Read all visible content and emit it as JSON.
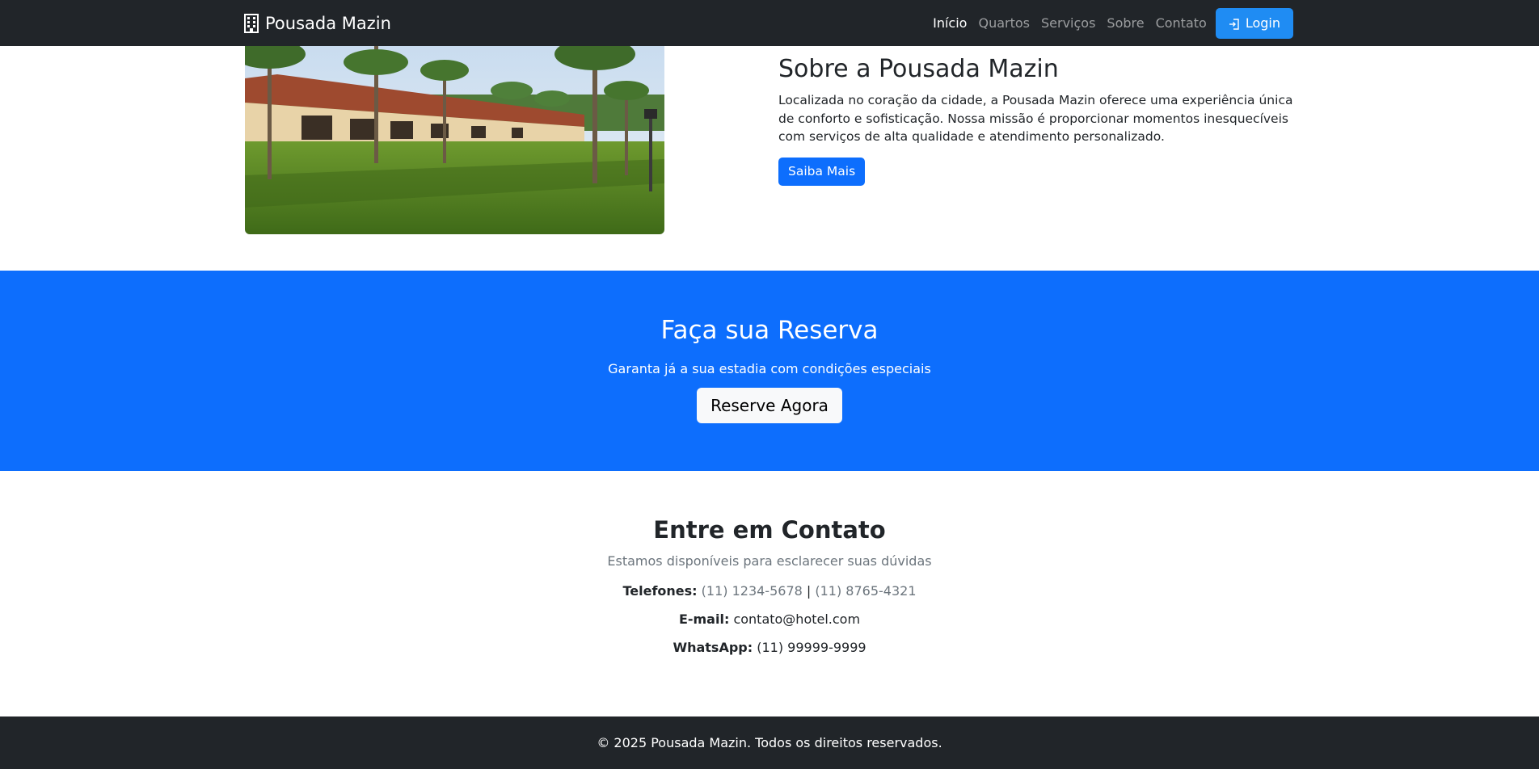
{
  "navbar": {
    "brand": "Pousada Mazin",
    "brand_icon": "building-icon",
    "links": [
      {
        "label": "Início",
        "active": true
      },
      {
        "label": "Quartos",
        "active": false
      },
      {
        "label": "Serviços",
        "active": false
      },
      {
        "label": "Sobre",
        "active": false
      },
      {
        "label": "Contato",
        "active": false
      }
    ],
    "login_label": "Login",
    "login_icon": "login-arrow-icon"
  },
  "about": {
    "title": "Sobre a Pousada Mazin",
    "description": "Localizada no coração da cidade, a Pousada Mazin oferece uma experiência única de conforto e sofisticação. Nossa missão é proporcionar momentos inesquecíveis com serviços de alta qualidade e atendimento personalizado.",
    "button_label": "Saiba Mais"
  },
  "reserva": {
    "title": "Faça sua Reserva",
    "subtitle": "Garanta já a sua estadia com condições especiais",
    "button_label": "Reserve Agora"
  },
  "contato": {
    "title": "Entre em Contato",
    "subtitle": "Estamos disponíveis para esclarecer suas dúvidas",
    "phones_label": "Telefones:",
    "phone1": "(11) 1234-5678",
    "phone_separator": "|",
    "phone2": "(11) 8765-4321",
    "email_label": "E-mail:",
    "email": "contato@hotel.com",
    "whatsapp_label": "WhatsApp:",
    "whatsapp": "(11) 99999-9999"
  },
  "footer": {
    "text": "© 2025 Pousada Mazin. Todos os direitos reservados."
  },
  "colors": {
    "navbar_bg": "#212529",
    "primary": "#0d6efd",
    "login_bg": "#1f8cf3"
  }
}
